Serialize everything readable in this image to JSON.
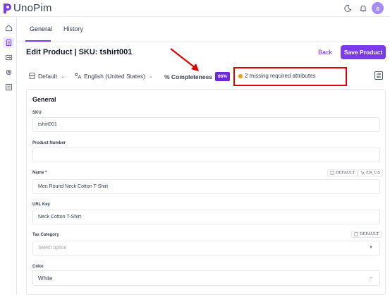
{
  "app": {
    "name": "UnoPim"
  },
  "user": {
    "avatar_letter": "a"
  },
  "tabs": [
    {
      "label": "General",
      "active": true
    },
    {
      "label": "History",
      "active": false
    }
  ],
  "header": {
    "title": "Edit Product | SKU: tshirt001",
    "back_label": "Back",
    "save_label": "Save Product"
  },
  "toolbar": {
    "channel": "Default",
    "locale": "English (United States)",
    "completeness_label": "% Completeness",
    "completeness_value": "86%",
    "missing_text": "2 missing required attributes"
  },
  "form": {
    "section_title": "General",
    "sku": {
      "label": "SKU",
      "value": "tshirt001"
    },
    "product_number": {
      "label": "Product Number",
      "value": ""
    },
    "name": {
      "label": "Name *",
      "value": "Men Round Neck Cotton T-Shirt",
      "chip_channel": "DEFAULT",
      "chip_locale": "EN_US"
    },
    "url_key": {
      "label": "URL Key",
      "value": "Neck Cotton T-Shirt"
    },
    "tax_category": {
      "label": "Tax Category",
      "placeholder": "Select option",
      "chip_channel": "DEFAULT"
    },
    "color": {
      "label": "Color",
      "value": "White"
    }
  },
  "colors": {
    "accent": "#7c3aed",
    "highlight": "#e00000",
    "warning_dot": "#f59e0b"
  },
  "icons": [
    "moon-icon",
    "bell-icon",
    "dashboard-icon",
    "catalog-icon",
    "data-transfer-icon",
    "settings-icon",
    "configuration-icon",
    "store-icon",
    "translate-icon",
    "sliders-icon",
    "globe-icon"
  ]
}
